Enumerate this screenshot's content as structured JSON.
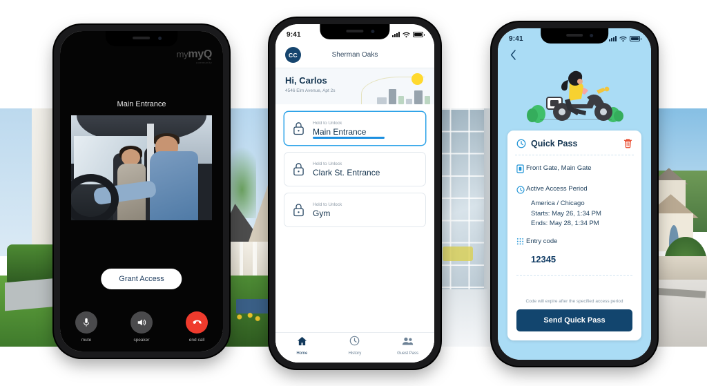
{
  "phone_call": {
    "brand": {
      "name": "myQ",
      "sub": "community"
    },
    "title": "Main Entrance",
    "grant_label": "Grant Access",
    "controls": [
      {
        "name": "mute",
        "label": "mute",
        "icon": "microphone-icon"
      },
      {
        "name": "speaker",
        "label": "speaker",
        "icon": "speaker-icon"
      },
      {
        "name": "end-call",
        "label": "end call",
        "icon": "end-call-icon"
      }
    ]
  },
  "phone_home": {
    "status": {
      "time": "9:41"
    },
    "avatar_initials": "CC",
    "community": "Sherman Oaks",
    "greeting": "Hi, Carlos",
    "address": "4546 Elm Avenue, Apt 2s",
    "doors": [
      {
        "hold_label": "Hold to Unlock",
        "name": "Main Entrance",
        "active": true
      },
      {
        "hold_label": "Hold to Unlock",
        "name": "Clark St. Entrance",
        "active": false
      },
      {
        "hold_label": "Hold to Unlock",
        "name": "Gym",
        "active": false
      }
    ],
    "tabs": [
      {
        "label": "Home",
        "icon": "home-icon",
        "active": true
      },
      {
        "label": "History",
        "icon": "clock-icon",
        "active": false
      },
      {
        "label": "Guest Pass",
        "icon": "people-icon",
        "active": false
      }
    ]
  },
  "phone_quickpass": {
    "status": {
      "time": "9:41"
    },
    "back_icon": "chevron-left-icon",
    "illustration": "delivery-scooter-illustration",
    "card_title": "Quick Pass",
    "delete_icon": "trash-icon",
    "gates": "Front Gate, Main Gate",
    "period_label": "Active Access Period",
    "timezone": "America / Chicago",
    "starts": "Starts: May 26, 1:34 PM",
    "ends": "Ends: May 28, 1:34 PM",
    "entry_code_label": "Entry code",
    "entry_code": "12345",
    "expire_note": "Code will expire after the specified access period",
    "send_label": "Send Quick Pass"
  },
  "colors": {
    "accent_blue": "#2ea3e8",
    "navy": "#12456e",
    "sky": "#aadcf5",
    "danger": "#ef3b2d"
  }
}
